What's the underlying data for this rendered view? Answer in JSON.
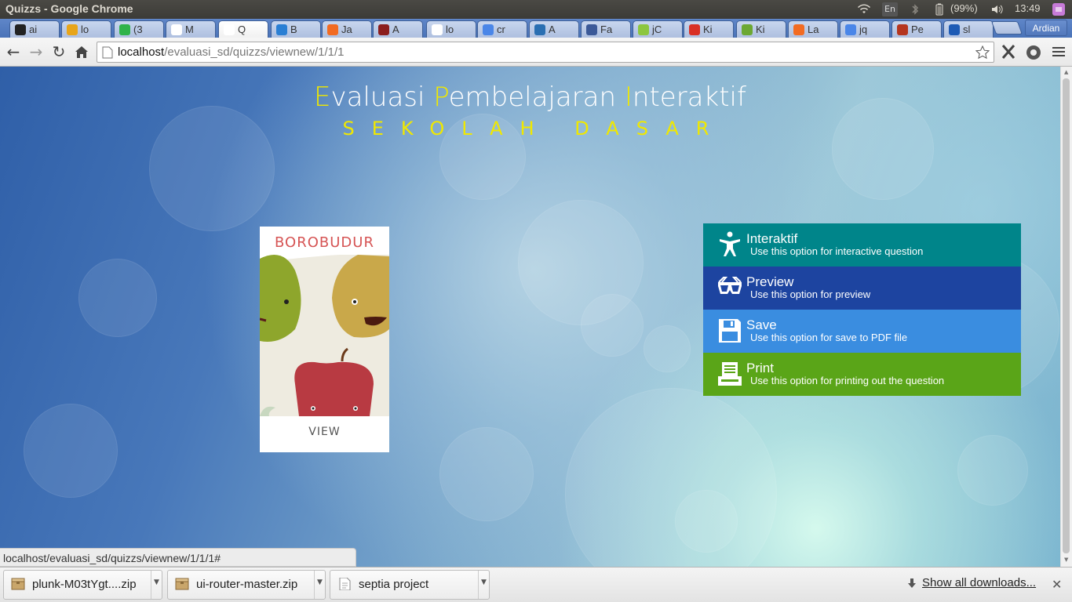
{
  "window": {
    "title": "Quizzs - Google Chrome",
    "user": "Ardian"
  },
  "tray": {
    "language": "En",
    "battery": "(99%)",
    "time": "13:49"
  },
  "tabs": [
    {
      "label": "ai",
      "fav_color": "#222222"
    },
    {
      "label": "lo",
      "fav_color": "#e8a51a"
    },
    {
      "label": "(3",
      "fav_color": "#2fb34a"
    },
    {
      "label": "M",
      "fav_color": "#ffffff"
    },
    {
      "label": "Q",
      "fav_color": "#ffffff",
      "active": true
    },
    {
      "label": "B",
      "fav_color": "#2a7fd4"
    },
    {
      "label": "Ja",
      "fav_color": "#f26b22"
    },
    {
      "label": "A",
      "fav_color": "#8b1d1d"
    },
    {
      "label": "lo",
      "fav_color": "#ffffff"
    },
    {
      "label": "cr",
      "fav_color": "#4a86e8"
    },
    {
      "label": "A",
      "fav_color": "#2a6fb2"
    },
    {
      "label": "Fa",
      "fav_color": "#3b5998"
    },
    {
      "label": "jC",
      "fav_color": "#8cc63f"
    },
    {
      "label": "Ki",
      "fav_color": "#d93025"
    },
    {
      "label": "Ki",
      "fav_color": "#6ca833"
    },
    {
      "label": "La",
      "fav_color": "#f26b22"
    },
    {
      "label": "jq",
      "fav_color": "#4a86e8"
    },
    {
      "label": "Pe",
      "fav_color": "#b5361f"
    },
    {
      "label": "sl",
      "fav_color": "#1e5bb5"
    }
  ],
  "address": {
    "host": "localhost",
    "path": "/evaluasi_sd/quizzs/viewnew/1/1/1"
  },
  "page": {
    "heading_parts": [
      {
        "text": "E",
        "hl": true
      },
      {
        "text": "valuasi ",
        "hl": false
      },
      {
        "text": "P",
        "hl": true
      },
      {
        "text": "embelajaran ",
        "hl": false
      },
      {
        "text": "I",
        "hl": true
      },
      {
        "text": "nteraktif",
        "hl": false
      }
    ],
    "subheading": "SEKOLAH DASAR",
    "card": {
      "title": "BOROBUDUR",
      "action": "VIEW"
    },
    "options": [
      {
        "title": "Interaktif",
        "desc": "Use this option for interactive question",
        "color": "#00858a",
        "icon": "accessibility-icon"
      },
      {
        "title": "Preview",
        "desc": "Use this option for preview",
        "color": "#1d44a0",
        "icon": "3d-glasses-icon"
      },
      {
        "title": "Save",
        "desc": "Use this option for save to PDF file",
        "color": "#3a8de0",
        "icon": "floppy-disk-icon"
      },
      {
        "title": "Print",
        "desc": "Use this option for printing out the question",
        "color": "#5aa518",
        "icon": "printer-icon"
      }
    ]
  },
  "status_url": "localhost/evaluasi_sd/quizzs/viewnew/1/1/1#",
  "downloads": {
    "items": [
      {
        "name": "plunk-M03tYgt....zip",
        "icon": "archive-icon"
      },
      {
        "name": "ui-router-master.zip",
        "icon": "archive-icon"
      },
      {
        "name": "septia project",
        "icon": "document-icon"
      }
    ],
    "show_all": "Show all downloads..."
  }
}
